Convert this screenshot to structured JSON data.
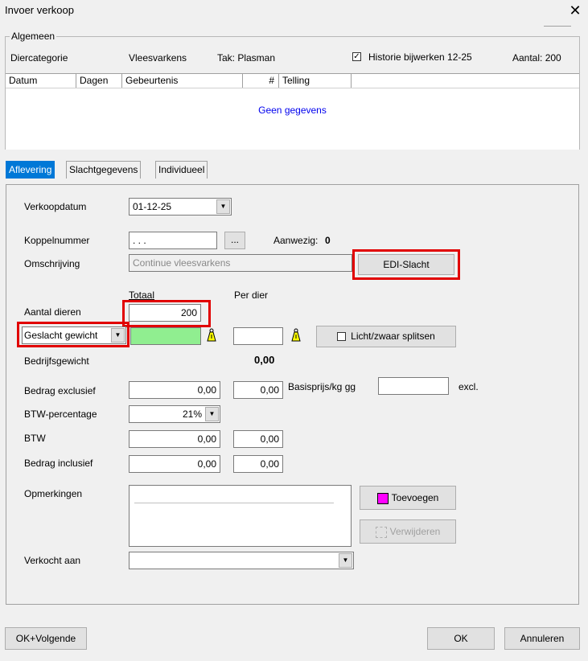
{
  "window": {
    "title": "Invoer verkoop"
  },
  "algemeen": {
    "legend": "Algemeen",
    "diercategorie_label": "Diercategorie",
    "diercategorie_value": "Vleesvarkens",
    "tak": "Tak: Plasman",
    "historie_label": "Historie bijwerken 12-25",
    "historie_checked": true,
    "aantal": "Aantal: 200",
    "grid_headers": [
      "Datum",
      "Dagen",
      "Gebeurtenis",
      "#",
      "Telling"
    ],
    "empty_message": "Geen gegevens"
  },
  "tabs": [
    {
      "label": "Aflevering",
      "active": true
    },
    {
      "label": "Slachtgegevens",
      "active": false
    },
    {
      "label": "Individueel",
      "active": false
    }
  ],
  "form": {
    "verkoopdatum_label": "Verkoopdatum",
    "verkoopdatum_value": "01-12-25",
    "koppelnummer_label": "Koppelnummer",
    "koppelnummer_value": ". . .",
    "browse_label": "...",
    "aanwezig_label": "Aanwezig:",
    "aanwezig_value": "0",
    "omschrijving_label": "Omschrijving",
    "omschrijving_value": "Continue vleesvarkens",
    "edi_button": "EDI-Slacht",
    "totaal_header": "Totaal",
    "per_dier_header": "Per dier",
    "aantal_dieren_label": "Aantal dieren",
    "aantal_dieren_value": "200",
    "gewicht_type": "Geslacht gewicht",
    "licht_zwaar_label": "Licht/zwaar splitsen",
    "bedrijfsgewicht_label": "Bedrijfsgewicht",
    "bedrijfsgewicht_value": "0,00",
    "bedrag_excl_label": "Bedrag exclusief",
    "bedrag_excl_total": "0,00",
    "bedrag_excl_per": "0,00",
    "basisprijs_label": "Basisprijs/kg gg",
    "basisprijs_value": "",
    "excl_label": "excl.",
    "btw_perc_label": "BTW-percentage",
    "btw_perc_value": "21%",
    "btw_label": "BTW",
    "btw_total": "0,00",
    "btw_per": "0,00",
    "bedrag_incl_label": "Bedrag inclusief",
    "bedrag_incl_total": "0,00",
    "bedrag_incl_per": "0,00",
    "opmerkingen_label": "Opmerkingen",
    "toevoegen_button": "Toevoegen",
    "verwijderen_button": "Verwijderen",
    "verkocht_aan_label": "Verkocht aan",
    "verkocht_aan_value": ""
  },
  "footer": {
    "ok_volgende": "OK+Volgende",
    "ok": "OK",
    "annuleren": "Annuleren"
  },
  "colors": {
    "accent": "#0078d7",
    "highlight_field": "#90ee90",
    "annotation_red": "#e10000",
    "link_blue": "#0000ee"
  }
}
